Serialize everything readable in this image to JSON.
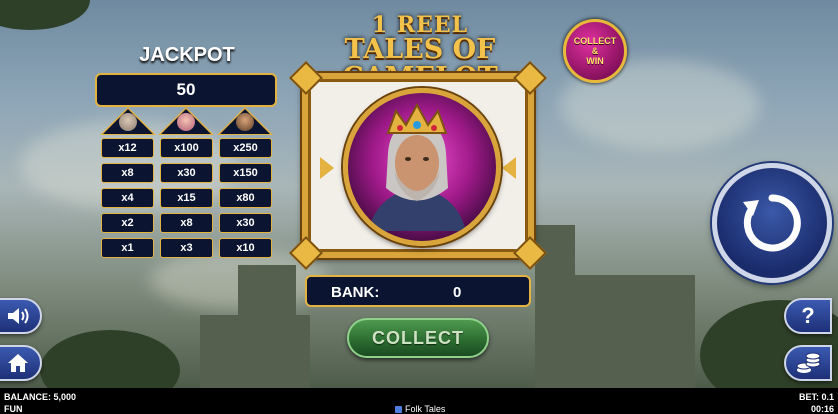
{
  "logo": {
    "line1": "1 REEL",
    "line2": "TALES OF CAMELOT"
  },
  "badge": {
    "line1": "COLLECT",
    "line2": "&",
    "line3": "WIN"
  },
  "jackpot": {
    "title": "JACKPOT",
    "value": "50",
    "columns": [
      "old-king-face-icon",
      "queen-face-icon",
      "king-face-icon"
    ],
    "rows": [
      [
        "x12",
        "x100",
        "x250"
      ],
      [
        "x8",
        "x30",
        "x150"
      ],
      [
        "x4",
        "x15",
        "x80"
      ],
      [
        "x2",
        "x8",
        "x30"
      ],
      [
        "x1",
        "x3",
        "x10"
      ]
    ]
  },
  "reel": {
    "symbol": "king-arthur-symbol-icon"
  },
  "bank": {
    "label": "BANK:",
    "value": "0"
  },
  "collect_button": {
    "label": "COLLECT"
  },
  "status": {
    "balance": "BALANCE: 5,000",
    "mode": "FUN",
    "game_name": "Folk Tales",
    "bet": "BET: 0.1",
    "time": "00:16"
  },
  "colors": {
    "gold": "#e3b240",
    "panel": "#0b1430",
    "collect_green": "#2a6a2f",
    "spin_blue": "#1a2b6b"
  }
}
